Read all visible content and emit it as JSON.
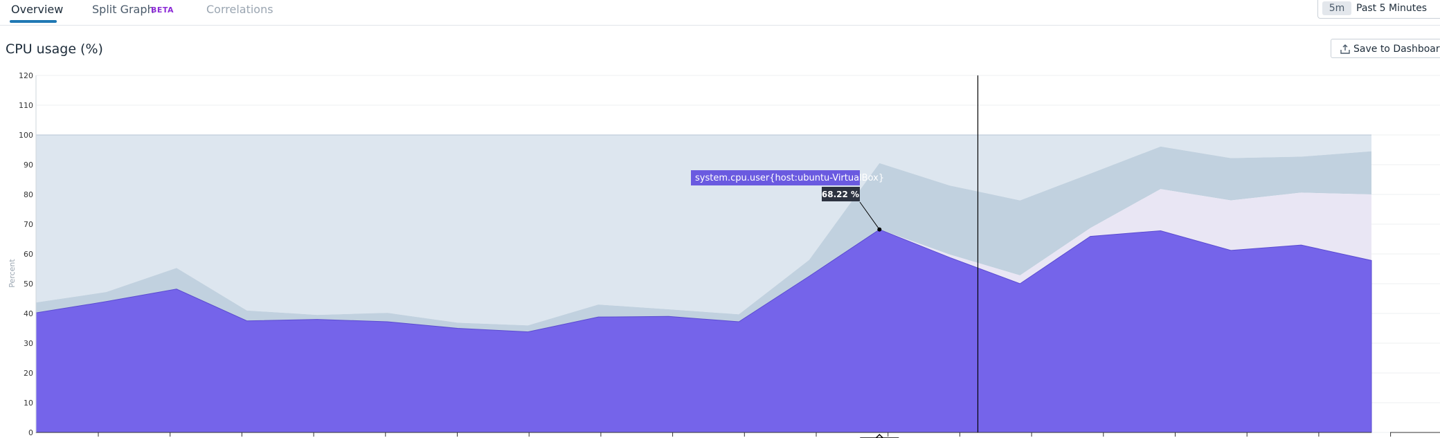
{
  "tabs": [
    {
      "label": "Overview",
      "state": "active"
    },
    {
      "label": "Split Graph",
      "state": "inactive",
      "badge": "BETA"
    },
    {
      "label": "Correlations",
      "state": "disabled"
    }
  ],
  "timeframe": {
    "chip": "5m",
    "label": "Past 5 Minutes"
  },
  "widget": {
    "title": "CPU usage (%)",
    "save_label": "Save to Dashboard",
    "save_icon": "upload-icon"
  },
  "tooltip": {
    "series": "system.cpu.user{host:ubuntu-VirtualBox}",
    "value": "68.22 %"
  },
  "colors": {
    "user": "#7564ea",
    "system": "#c1d1df",
    "iowait": "#e9e6f4",
    "idle": "#dde6ef",
    "guide": "#000000"
  },
  "chart_data": {
    "type": "area",
    "stacked": true,
    "ylabel": "Percent",
    "ylim": [
      0,
      120
    ],
    "yticks": [
      0,
      10,
      20,
      30,
      40,
      50,
      60,
      70,
      80,
      90,
      100,
      110,
      120
    ],
    "x": [
      0,
      1,
      2,
      3,
      4,
      5,
      6,
      7,
      8,
      9,
      10,
      11,
      12,
      13,
      14,
      15,
      16,
      17,
      18,
      19,
      20
    ],
    "series": [
      {
        "values": [
          40.2,
          44,
          48.2,
          37.5,
          38,
          37.2,
          35,
          33.8,
          38.8,
          39,
          37.2,
          52.5,
          68.22,
          58.8,
          50,
          65.9,
          67.8,
          61.2,
          63,
          57.8
        ]
      },
      {
        "values": [
          0,
          0,
          0,
          0,
          0,
          0,
          0,
          0,
          0,
          0,
          0,
          0,
          0,
          1,
          2.8,
          2.8,
          14,
          16.8,
          17.6,
          22.2
        ]
      },
      {
        "values": [
          3.5,
          3.2,
          7.1,
          3.5,
          1.5,
          3,
          1.9,
          2.2,
          4.2,
          2.4,
          2.5,
          5.5,
          22.3,
          23.2,
          25.2,
          18.3,
          14.3,
          14.2,
          12.1,
          14.5
        ]
      },
      {
        "values": [
          56.3,
          52.8,
          44.7,
          59,
          60.5,
          59.8,
          63.1,
          64,
          57,
          58.6,
          60.3,
          42,
          9.48,
          17,
          22,
          13,
          3.9,
          7.8,
          7.3,
          5.5
        ]
      }
    ],
    "crosshair_index": 13.4,
    "highlight_index": 12,
    "grid": true
  }
}
